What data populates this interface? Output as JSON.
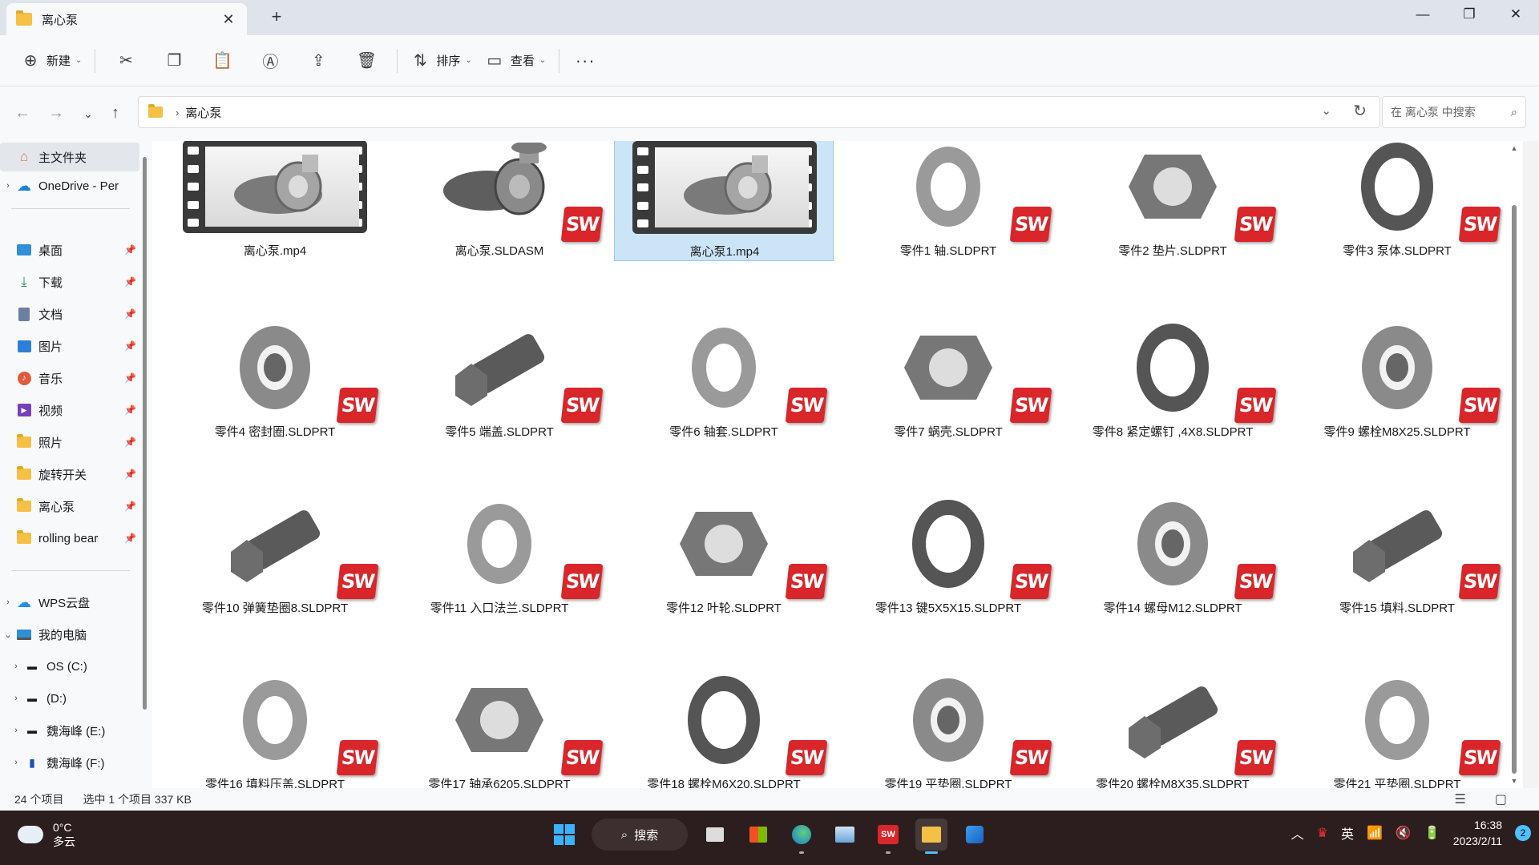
{
  "window": {
    "tab_title": "离心泵",
    "new_tab": "+",
    "close_tab": "✕",
    "minimize": "—",
    "restore": "❐",
    "close": "✕"
  },
  "toolbar": {
    "new_label": "新建",
    "sort_label": "排序",
    "view_label": "查看",
    "more": "···"
  },
  "address": {
    "crumb": "离心泵",
    "search_placeholder": "在 离心泵 中搜索"
  },
  "sidebar": {
    "home": "主文件夹",
    "onedrive": "OneDrive - Per",
    "quick": [
      {
        "label": "桌面",
        "icon": "desktop-icon",
        "color": "#2f8fd8"
      },
      {
        "label": "下载",
        "icon": "download-icon",
        "color": "#2f9e5b"
      },
      {
        "label": "文档",
        "icon": "document-icon",
        "color": "#6b7fa3"
      },
      {
        "label": "图片",
        "icon": "pictures-icon",
        "color": "#2f7fd8"
      },
      {
        "label": "音乐",
        "icon": "music-icon",
        "color": "#e05a3c"
      },
      {
        "label": "视频",
        "icon": "video-icon",
        "color": "#7a3fb8"
      },
      {
        "label": "照片",
        "icon": "folder-icon",
        "color": "#f4c045"
      },
      {
        "label": "旋转开关",
        "icon": "folder-icon",
        "color": "#f4c045"
      },
      {
        "label": "离心泵",
        "icon": "folder-icon",
        "color": "#f4c045"
      },
      {
        "label": "rolling bear",
        "icon": "folder-icon",
        "color": "#f4c045"
      }
    ],
    "wps": "WPS云盘",
    "thispc": "我的电脑",
    "drives": [
      {
        "label": "OS (C:)"
      },
      {
        "label": "(D:)"
      },
      {
        "label": "魏海峰 (E:)"
      },
      {
        "label": "魏海峰 (F:)"
      }
    ]
  },
  "files": [
    {
      "name": "离心泵.mp4",
      "kind": "video"
    },
    {
      "name": "离心泵.SLDASM",
      "kind": "asm"
    },
    {
      "name": "离心泵1.mp4",
      "kind": "video",
      "selected": true
    },
    {
      "name": "零件1 轴.SLDPRT",
      "kind": "part"
    },
    {
      "name": "零件2 垫片.SLDPRT",
      "kind": "part"
    },
    {
      "name": "零件3 泵体.SLDPRT",
      "kind": "part"
    },
    {
      "name": "零件4 密封圈.SLDPRT",
      "kind": "part"
    },
    {
      "name": "零件5 端盖.SLDPRT",
      "kind": "part"
    },
    {
      "name": "零件6 轴套.SLDPRT",
      "kind": "part"
    },
    {
      "name": "零件7 蜗壳.SLDPRT",
      "kind": "part"
    },
    {
      "name": "零件8 紧定螺钉 ,4X8.SLDPRT",
      "kind": "part"
    },
    {
      "name": "零件9 螺栓M8X25.SLDPRT",
      "kind": "part"
    },
    {
      "name": "零件10 弹簧垫圈8.SLDPRT",
      "kind": "part"
    },
    {
      "name": "零件11 入口法兰.SLDPRT",
      "kind": "part"
    },
    {
      "name": "零件12 叶轮.SLDPRT",
      "kind": "part"
    },
    {
      "name": "零件13 键5X5X15.SLDPRT",
      "kind": "part"
    },
    {
      "name": "零件14 螺母M12.SLDPRT",
      "kind": "part"
    },
    {
      "name": "零件15 填料.SLDPRT",
      "kind": "part"
    },
    {
      "name": "零件16 填料压盖.SLDPRT",
      "kind": "part"
    },
    {
      "name": "零件17 轴承6205.SLDPRT",
      "kind": "part"
    },
    {
      "name": "零件18 螺栓M6X20.SLDPRT",
      "kind": "part"
    },
    {
      "name": "零件19 平垫圈.SLDPRT",
      "kind": "part"
    },
    {
      "name": "零件20 螺栓M8X35.SLDPRT",
      "kind": "part"
    },
    {
      "name": "零件21 平垫圈.SLDPRT",
      "kind": "part"
    }
  ],
  "sw_badge": "SW",
  "status": {
    "count": "24 个项目",
    "selection": "选中 1 个项目  337 KB"
  },
  "taskbar": {
    "temp": "0°C",
    "weather": "多云",
    "search": "搜索",
    "ime": "英",
    "time": "16:38",
    "date": "2023/2/11",
    "notifications": "2"
  },
  "colors": {
    "accent": "#0078d4",
    "selection": "#cce4f7",
    "sw_red": "#d9262a",
    "taskbar": "#2c1e1e"
  }
}
